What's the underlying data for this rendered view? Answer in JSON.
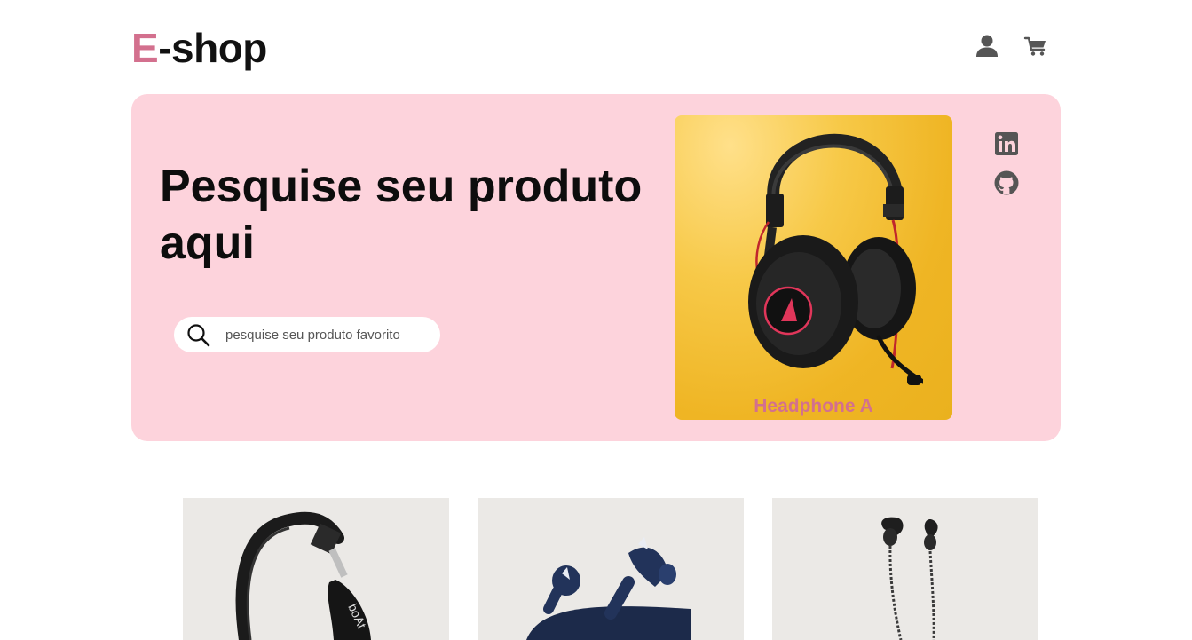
{
  "header": {
    "logo_accent": "E",
    "logo_rest": "-shop",
    "user_icon": "user-icon",
    "cart_icon": "cart-icon"
  },
  "hero": {
    "title": "Pesquise seu produto aqui",
    "search": {
      "placeholder": "pesquise seu produto favorito",
      "value": ""
    },
    "featured": {
      "label": "Headphone A"
    },
    "social": [
      "linkedin-icon",
      "github-icon"
    ]
  },
  "products": [
    {
      "image": "headphone-image"
    },
    {
      "image": "earbuds-image"
    },
    {
      "image": "earphones-image"
    }
  ],
  "colors": {
    "accent": "#d3708e",
    "hero_bg": "#fdd3dc",
    "featured_bg": "#efb524",
    "card_bg": "#ebe9e6",
    "icon": "#555555"
  }
}
